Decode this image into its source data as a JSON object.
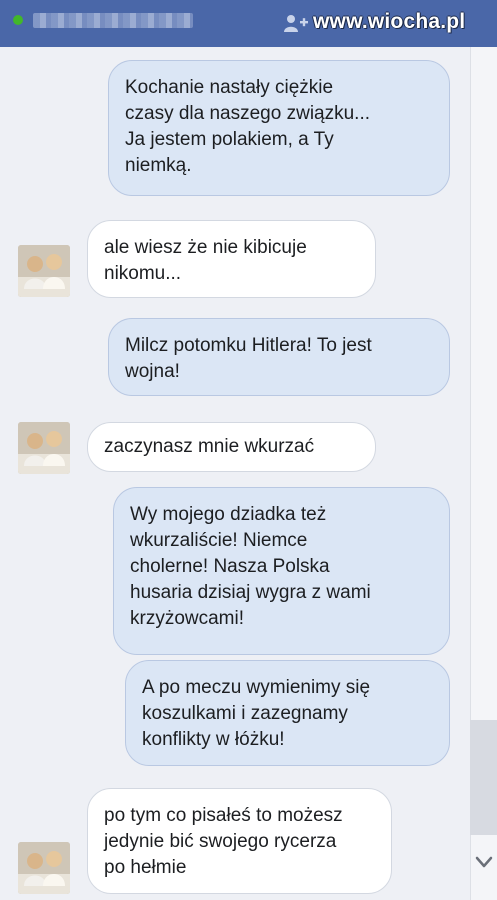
{
  "header": {
    "contact_name_blurred": "",
    "watermark": "www.wiocha.pl",
    "online_color": "#42b72a",
    "icons": {
      "add_friend": "add-friend-icon",
      "online": "online-dot-icon"
    }
  },
  "messages": [
    {
      "side": "out",
      "text": "Kochanie nastały ciężkie\nczasy dla naszego związku...\nJa jestem polakiem, a Ty\nniemką."
    },
    {
      "side": "in",
      "text": "ale wiesz że nie kibicuje\nnikomu..."
    },
    {
      "side": "out",
      "text": "Milcz potomku Hitlera! To jest\nwojna!"
    },
    {
      "side": "in",
      "text": "zaczynasz mnie wkurzać"
    },
    {
      "side": "out",
      "text": "Wy mojego dziadka też\nwkurzaliście! Niemce\ncholerne! Nasza Polska\nhusaria dzisiaj wygra z wami\nkrzyżowcami!"
    },
    {
      "side": "out",
      "text": "A po meczu wymienimy się\nkoszulkami i zazegnamy\nkonflikty w łóżku!"
    },
    {
      "side": "in",
      "text": "po tym co pisałeś to możesz\njedynie bić swojego rycerza\npo hełmie"
    }
  ],
  "colors": {
    "header": "#4a67a8",
    "outgoing_bubble": "#dbe6f5",
    "incoming_bubble": "#ffffff",
    "background": "#eef0f5"
  },
  "scrollbar": {
    "icon": "chevron-down-icon"
  }
}
